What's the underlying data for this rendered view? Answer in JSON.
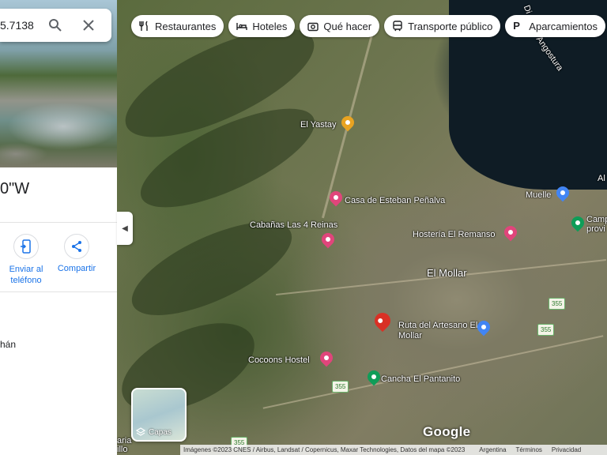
{
  "search": {
    "value": "5.7138"
  },
  "place": {
    "title": "0\"W",
    "detail": "hán"
  },
  "actions": [
    {
      "label": "Enviar al teléfono",
      "icon": "send-to-phone-icon"
    },
    {
      "label": "Compartir",
      "icon": "share-icon"
    }
  ],
  "chips": [
    {
      "label": "Restaurantes",
      "icon": "restaurant-icon"
    },
    {
      "label": "Hoteles",
      "icon": "hotel-icon"
    },
    {
      "label": "Qué hacer",
      "icon": "camera-icon"
    },
    {
      "label": "Transporte público",
      "icon": "transit-icon"
    },
    {
      "label": "Aparcamientos",
      "icon": "parking-icon"
    }
  ],
  "map_labels": {
    "el_yastay": "El Yastay",
    "casa_esteban": "Casa de Esteban Peñalva",
    "cabanas": "Cabañas Las 4 Reinas",
    "hosteria": "Hostería El Remanso",
    "el_mollar": "El Mollar",
    "ruta_artesano": "Ruta del Artesano El Mollar",
    "cocoons": "Cocoons Hostel",
    "cancha": "Cancha El Pantanito",
    "muelle": "Muelle",
    "camp": "Camp provi",
    "angostura": "Angostura",
    "die": "Di",
    "al": "Al",
    "left_edge": "aria illo",
    "road_355_a": "355",
    "road_355_b": "355",
    "road_355_c": "355",
    "road_355_d": "355"
  },
  "layers": {
    "label": "Capas"
  },
  "brand": "Google",
  "attribution": {
    "imagery": "Imágenes ©2023 CNES / Airbus, Landsat / Copernicus, Maxar Technologies, Datos del mapa ©2023",
    "country": "Argentina",
    "terms": "Términos",
    "privacy": "Privacidad"
  },
  "colors": {
    "pin_red": "#d93025",
    "pin_hotel": "#e0457b",
    "pin_attraction": "#0f9d58",
    "pin_food": "#e8a321",
    "link_blue": "#1a73e8"
  }
}
